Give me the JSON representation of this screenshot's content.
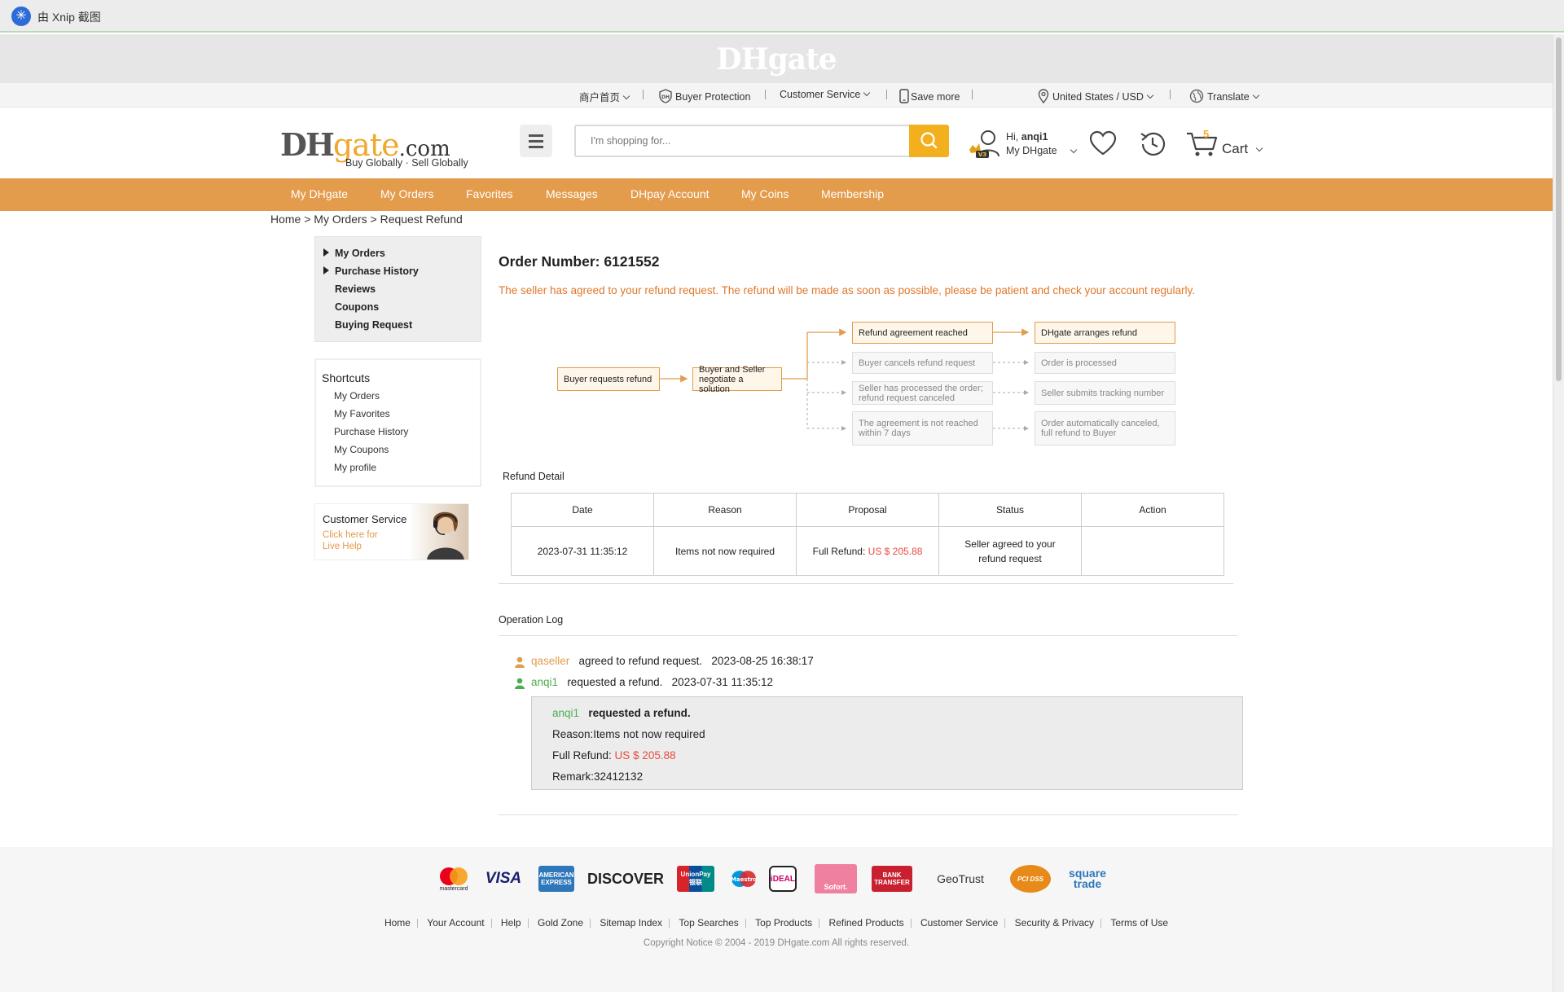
{
  "window": {
    "title": "由 Xnip 截图"
  },
  "brand_strip": {
    "logo_text": "DHgate"
  },
  "utility_bar": {
    "merchant_home": "商户首页",
    "buyer_protection": "Buyer Protection",
    "customer_service": "Customer Service",
    "save_more": "Save more",
    "region": "United States / USD",
    "translate": "Translate"
  },
  "header": {
    "logo_dh": "DH",
    "logo_gate": "gate",
    "logo_com": ".com",
    "tagline": "Buy Globally · Sell Globally",
    "search_placeholder": "I'm shopping for...",
    "greeting_prefix": "Hi, ",
    "username": "anqi1",
    "my_dhgate": "My DHgate",
    "vip_badge": "V3",
    "cart_count": "5",
    "cart_label": "Cart"
  },
  "nav": {
    "items": [
      "My DHgate",
      "My Orders",
      "Favorites",
      "Messages",
      "DHpay Account",
      "My Coins",
      "Membership"
    ]
  },
  "breadcrumb": "Home > My Orders > Request Refund",
  "sidebar": {
    "menu": [
      "My Orders",
      "Purchase History",
      "Reviews",
      "Coupons",
      "Buying Request"
    ],
    "shortcuts_title": "Shortcuts",
    "shortcuts": [
      "My Orders",
      "My Favorites",
      "Purchase History",
      "My Coupons",
      "My profile"
    ],
    "cs_title": "Customer Service",
    "cs_link": "Click here for Live Help"
  },
  "order": {
    "title": "Order Number: 6121552",
    "message": "The seller has agreed to your refund request. The refund will be made as soon as possible, please be patient and check your account regularly."
  },
  "flow": {
    "buyer_requests": "Buyer requests refund",
    "negotiate": "Buyer and Seller\nnegotiate a solution",
    "agreement": "Refund agreement reached",
    "buyer_cancels": "Buyer cancels refund request",
    "seller_processed": "Seller has processed the order;\nrefund request canceled",
    "not_reached": "The agreement is not reached\nwithin 7 days",
    "dhgate_arranges": "DHgate arranges refund",
    "order_processed": "Order is processed",
    "seller_tracking": "Seller submits tracking number",
    "auto_canceled": "Order automatically canceled,\nfull refund to Buyer"
  },
  "refund_detail": {
    "title": "Refund Detail",
    "headers": [
      "Date",
      "Reason",
      "Proposal",
      "Status",
      "Action"
    ],
    "row": {
      "date": "2023-07-31 11:35:12",
      "reason": "Items not now required",
      "proposal_label": "Full Refund: ",
      "proposal_amount": "US $ 205.88",
      "status": "Seller agreed to your refund request",
      "action": ""
    }
  },
  "operation_log": {
    "title": "Operation Log",
    "entries": [
      {
        "user": "qaseller",
        "action": "agreed to refund request.",
        "time": "2023-08-25 16:38:17"
      },
      {
        "user": "anqi1",
        "action": "requested a refund.",
        "time": "2023-07-31 11:35:12"
      }
    ],
    "detail": {
      "user": "anqi1",
      "action": "requested a refund.",
      "reason": "Reason:Items not now required",
      "refund_label": "Full Refund: ",
      "refund_amount": "US $ 205.88",
      "remark": "Remark:32412132"
    }
  },
  "footer": {
    "payments": [
      "mastercard",
      "VISA",
      "AMERICAN EXPRESS",
      "DISCOVER",
      "UnionPay 银联",
      "Maestro",
      "iDEAL",
      "Sofort.",
      "BANK TRANSFER",
      "GeoTrust",
      "PCI DSS",
      "square trade"
    ],
    "links": [
      "Home",
      "Your Account",
      "Help",
      "Gold Zone",
      "Sitemap Index",
      "Top Searches",
      "Top Products",
      "Refined Products",
      "Customer Service",
      "Security & Privacy",
      "Terms of Use"
    ],
    "copyright": "Copyright Notice © 2004 - 2019 DHgate.com All rights reserved."
  }
}
